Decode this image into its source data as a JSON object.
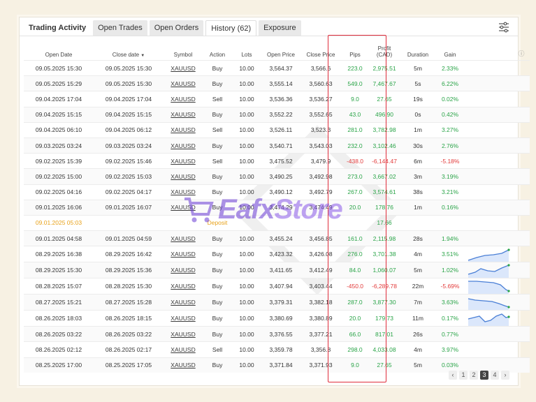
{
  "tabs": [
    {
      "label": "Trading Activity"
    },
    {
      "label": "Open Trades"
    },
    {
      "label": "Open Orders"
    },
    {
      "label": "History (62)"
    },
    {
      "label": "Exposure"
    }
  ],
  "columns": {
    "open_date": "Open Date",
    "close_date": "Close date",
    "close_date_sort": "▼",
    "symbol": "Symbol",
    "action": "Action",
    "lots": "Lots",
    "open_price": "Open Price",
    "close_price": "Close Price",
    "pips": "Pips",
    "profit_line1": "Profit",
    "profit_line2": "(CAD)",
    "duration": "Duration",
    "gain": "Gain",
    "info_icon": "ⓘ"
  },
  "rows": [
    {
      "open": "09.05.2025 15:30",
      "close": "09.05.2025 15:30",
      "symbol": "XAUUSD",
      "action": "Buy",
      "lots": "10.00",
      "op": "3,564.37",
      "cp": "3,566.6",
      "pips": "223.0",
      "profit": "2,975.51",
      "dur": "5m",
      "gain": "2.33%"
    },
    {
      "open": "09.05.2025 15:29",
      "close": "09.05.2025 15:30",
      "symbol": "XAUUSD",
      "action": "Buy",
      "lots": "10.00",
      "op": "3,555.14",
      "cp": "3,560.63",
      "pips": "549.0",
      "profit": "7,467.67",
      "dur": "5s",
      "gain": "6.22%"
    },
    {
      "open": "09.04.2025 17:04",
      "close": "09.04.2025 17:04",
      "symbol": "XAUUSD",
      "action": "Sell",
      "lots": "10.00",
      "op": "3,536.36",
      "cp": "3,536.27",
      "pips": "9.0",
      "profit": "27.65",
      "dur": "19s",
      "gain": "0.02%"
    },
    {
      "open": "09.04.2025 15:15",
      "close": "09.04.2025 15:15",
      "symbol": "XAUUSD",
      "action": "Buy",
      "lots": "10.00",
      "op": "3,552.22",
      "cp": "3,552.65",
      "pips": "43.0",
      "profit": "496.90",
      "dur": "0s",
      "gain": "0.42%"
    },
    {
      "open": "09.04.2025 06:10",
      "close": "09.04.2025 06:12",
      "symbol": "XAUUSD",
      "action": "Sell",
      "lots": "10.00",
      "op": "3,526.11",
      "cp": "3,523.3",
      "pips": "281.0",
      "profit": "3,782.98",
      "dur": "1m",
      "gain": "3.27%"
    },
    {
      "open": "09.03.2025 03:24",
      "close": "09.03.2025 03:24",
      "symbol": "XAUUSD",
      "action": "Buy",
      "lots": "10.00",
      "op": "3,540.71",
      "cp": "3,543.03",
      "pips": "232.0",
      "profit": "3,102.46",
      "dur": "30s",
      "gain": "2.76%"
    },
    {
      "open": "09.02.2025 15:39",
      "close": "09.02.2025 15:46",
      "symbol": "XAUUSD",
      "action": "Sell",
      "lots": "10.00",
      "op": "3,475.52",
      "cp": "3,479.9",
      "pips": "-438.0",
      "profit": "-6,144.47",
      "dur": "6m",
      "gain": "-5.18%"
    },
    {
      "open": "09.02.2025 15:00",
      "close": "09.02.2025 15:03",
      "symbol": "XAUUSD",
      "action": "Buy",
      "lots": "10.00",
      "op": "3,490.25",
      "cp": "3,492.98",
      "pips": "273.0",
      "profit": "3,667.02",
      "dur": "3m",
      "gain": "3.19%"
    },
    {
      "open": "09.02.2025 04:16",
      "close": "09.02.2025 04:17",
      "symbol": "XAUUSD",
      "action": "Buy",
      "lots": "10.00",
      "op": "3,490.12",
      "cp": "3,492.79",
      "pips": "267.0",
      "profit": "3,574.61",
      "dur": "38s",
      "gain": "3.21%"
    },
    {
      "open": "09.01.2025 16:06",
      "close": "09.01.2025 16:07",
      "symbol": "XAUUSD",
      "action": "Buy",
      "lots": "10.00",
      "op": "3,474.29",
      "cp": "3,474.49",
      "pips": "20.0",
      "profit": "178.76",
      "dur": "1m",
      "gain": "0.16%"
    },
    {
      "open": "09.01.2025 05:03",
      "close": "",
      "symbol": "",
      "action": "Deposit",
      "lots": "",
      "op": "",
      "cp": "",
      "pips": "",
      "profit": "17.66",
      "dur": "",
      "gain": "",
      "deposit": true
    },
    {
      "open": "09.01.2025 04:58",
      "close": "09.01.2025 04:59",
      "symbol": "XAUUSD",
      "action": "Buy",
      "lots": "10.00",
      "op": "3,455.24",
      "cp": "3,456.85",
      "pips": "161.0",
      "profit": "2,115.98",
      "dur": "28s",
      "gain": "1.94%"
    },
    {
      "open": "08.29.2025 16:38",
      "close": "08.29.2025 16:42",
      "symbol": "XAUUSD",
      "action": "Buy",
      "lots": "10.00",
      "op": "3,423.32",
      "cp": "3,426.08",
      "pips": "276.0",
      "profit": "3,701.38",
      "dur": "4m",
      "gain": "3.51%",
      "spark": "up1"
    },
    {
      "open": "08.29.2025 15:30",
      "close": "08.29.2025 15:36",
      "symbol": "XAUUSD",
      "action": "Buy",
      "lots": "10.00",
      "op": "3,411.65",
      "cp": "3,412.49",
      "pips": "84.0",
      "profit": "1,060.07",
      "dur": "5m",
      "gain": "1.02%",
      "spark": "up2"
    },
    {
      "open": "08.28.2025 15:07",
      "close": "08.28.2025 15:30",
      "symbol": "XAUUSD",
      "action": "Buy",
      "lots": "10.00",
      "op": "3,407.94",
      "cp": "3,403.44",
      "pips": "-450.0",
      "profit": "-6,289.78",
      "dur": "22m",
      "gain": "-5.69%",
      "spark": "down1"
    },
    {
      "open": "08.27.2025 15:21",
      "close": "08.27.2025 15:28",
      "symbol": "XAUUSD",
      "action": "Buy",
      "lots": "10.00",
      "op": "3,379.31",
      "cp": "3,382.18",
      "pips": "287.0",
      "profit": "3,877.30",
      "dur": "7m",
      "gain": "3.63%",
      "spark": "down2"
    },
    {
      "open": "08.26.2025 18:03",
      "close": "08.26.2025 18:15",
      "symbol": "XAUUSD",
      "action": "Buy",
      "lots": "10.00",
      "op": "3,380.69",
      "cp": "3,380.89",
      "pips": "20.0",
      "profit": "179.73",
      "dur": "11m",
      "gain": "0.17%",
      "spark": "wave"
    },
    {
      "open": "08.26.2025 03:22",
      "close": "08.26.2025 03:22",
      "symbol": "XAUUSD",
      "action": "Buy",
      "lots": "10.00",
      "op": "3,376.55",
      "cp": "3,377.21",
      "pips": "66.0",
      "profit": "817.01",
      "dur": "26s",
      "gain": "0.77%"
    },
    {
      "open": "08.26.2025 02:12",
      "close": "08.26.2025 02:17",
      "symbol": "XAUUSD",
      "action": "Sell",
      "lots": "10.00",
      "op": "3,359.78",
      "cp": "3,356.8",
      "pips": "298.0",
      "profit": "4,033.08",
      "dur": "4m",
      "gain": "3.97%"
    },
    {
      "open": "08.25.2025 17:00",
      "close": "08.25.2025 17:05",
      "symbol": "XAUUSD",
      "action": "Buy",
      "lots": "10.00",
      "op": "3,371.84",
      "cp": "3,371.93",
      "pips": "9.0",
      "profit": "27.65",
      "dur": "5m",
      "gain": "0.03%"
    }
  ],
  "pagination": {
    "prev": "‹",
    "pages": [
      "1",
      "2",
      "3",
      "4"
    ],
    "current": "3",
    "next": "›"
  },
  "watermark": {
    "brand": "Eafx",
    "store": "Store"
  },
  "colors": {
    "positive": "#2aa448",
    "negative": "#e23b3b",
    "deposit": "#e8a21a",
    "highlight_box": "#e02d3c",
    "spark_line": "#4a7fd6"
  }
}
